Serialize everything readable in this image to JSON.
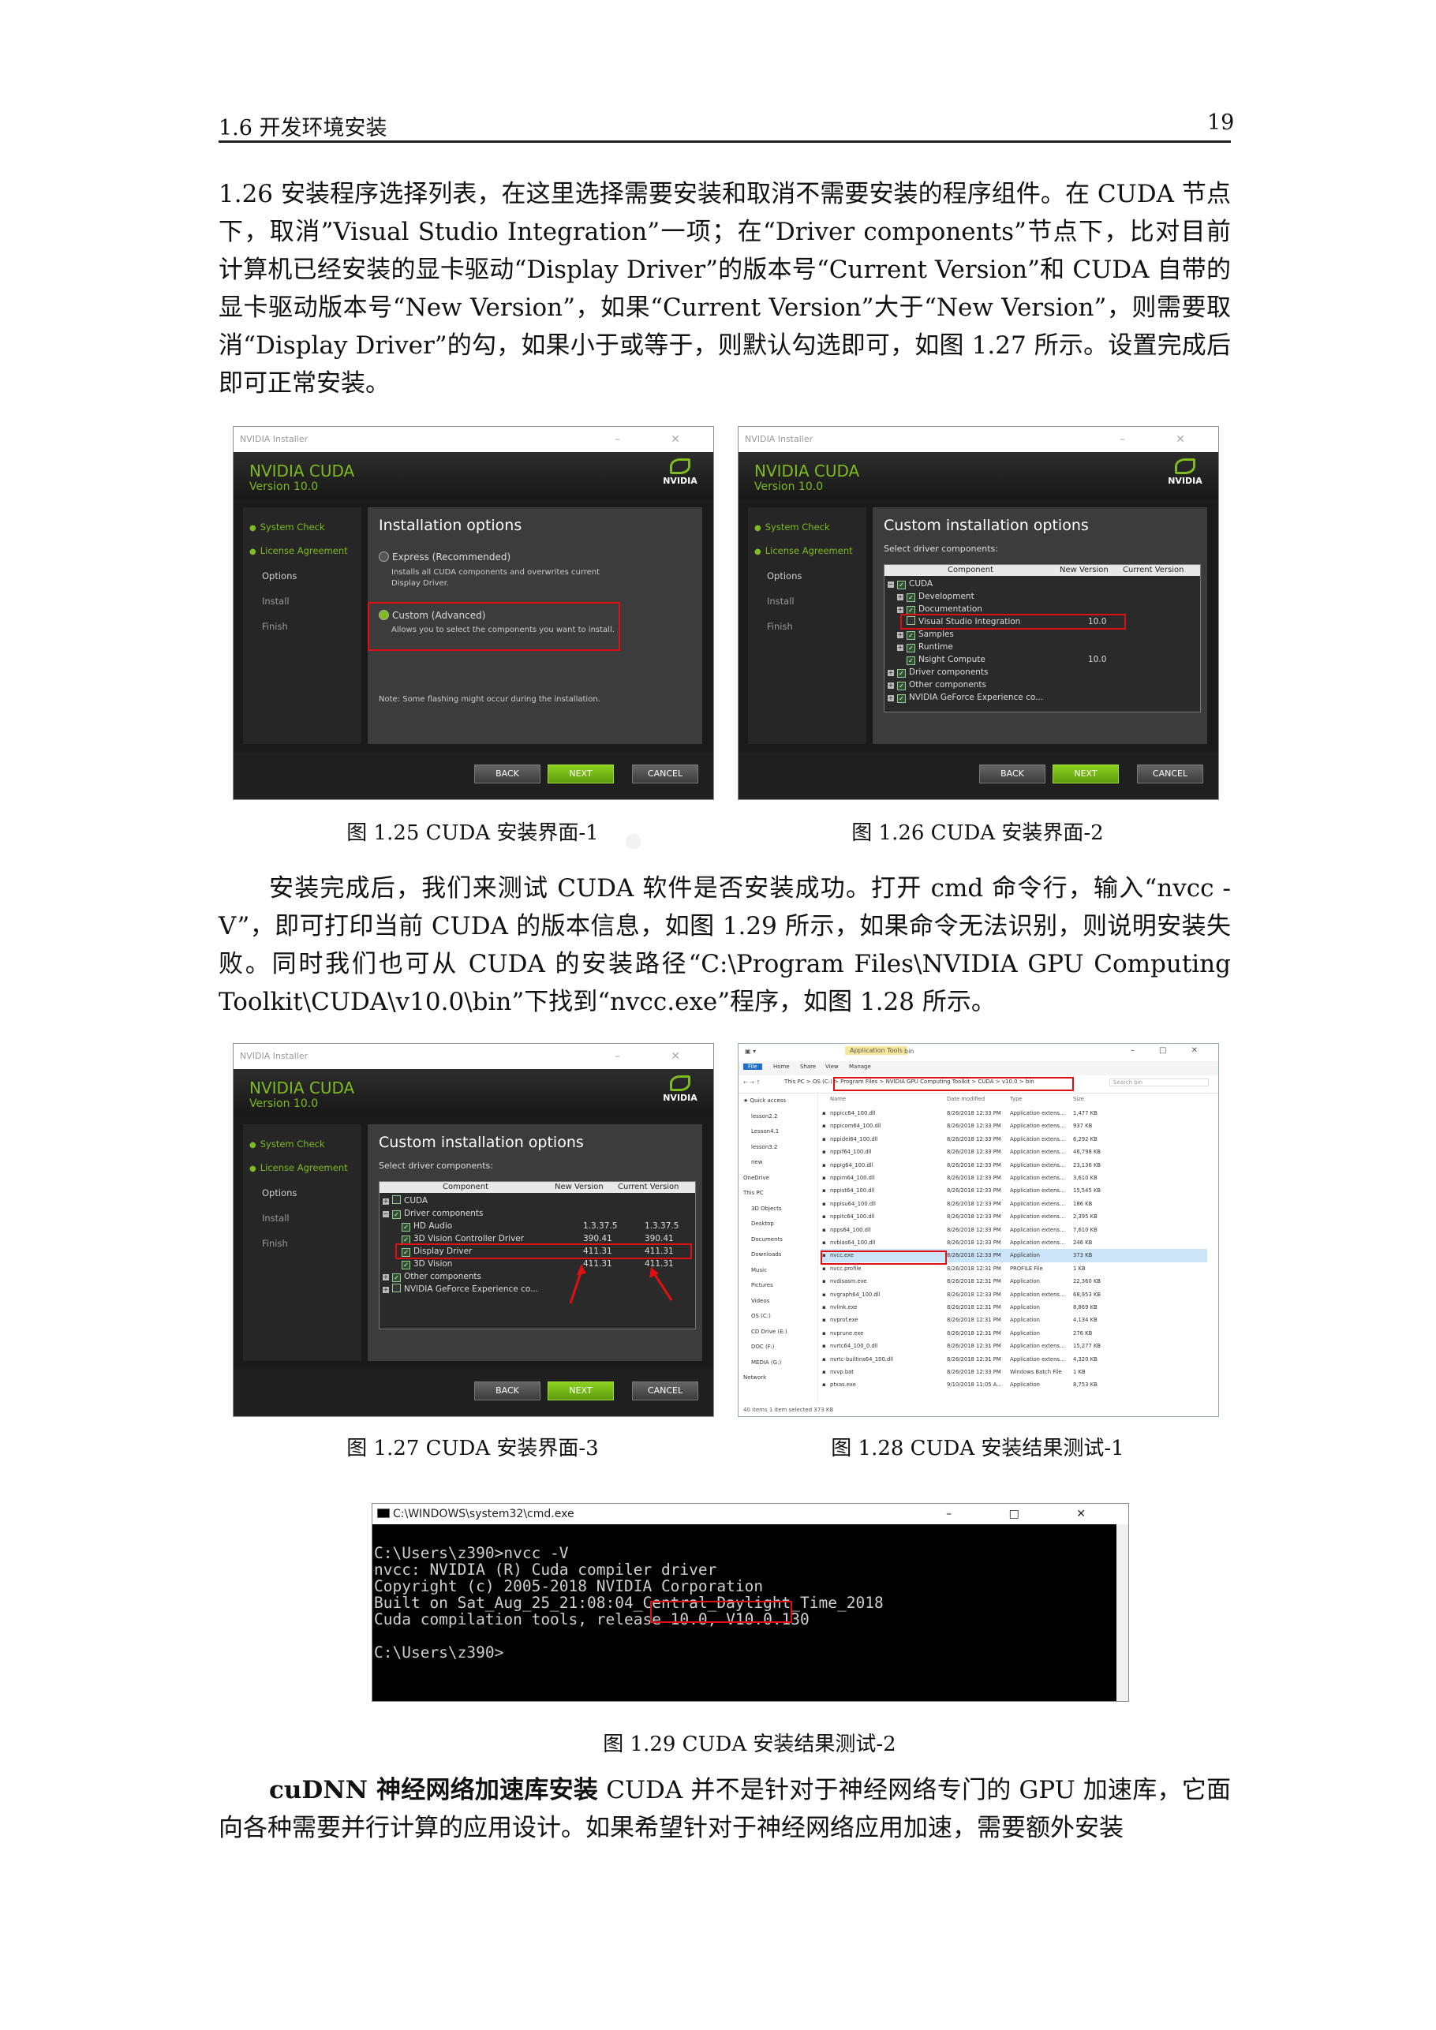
{
  "header": {
    "section": "1.6 开发环境安装",
    "page_number": "19"
  },
  "para1": "1.26 安装程序选择列表，在这里选择需要安装和取消不需要安装的程序组件。在 CUDA 节点下，取消”Visual Studio Integration”一项；在“Driver components”节点下，比对目前计算机已经安装的显卡驱动“Display Driver”的版本号“Current Version”和 CUDA 自带的显卡驱动版本号“New Version”，如果“Current Version”大于“New Version”，则需要取消“Display Driver”的勾，如果小于或等于，则默认勾选即可，如图 1.27 所示。设置完成后即可正常安装。",
  "para2": "安装完成后，我们来测试 CUDA 软件是否安装成功。打开 cmd 命令行，输入“nvcc -V”，即可打印当前 CUDA 的版本信息，如图 1.29 所示，如果命令无法识别，则说明安装失败。同时我们也可从 CUDA 的安装路径“C:\\Program Files\\NVIDIA GPU Computing Toolkit\\CUDA\\v10.0\\bin”下找到“nvcc.exe”程序，如图 1.28 所示。",
  "para3_bold": "cuDNN 神经网络加速库安装",
  "para3": "CUDA 并不是针对于神经网络专门的 GPU 加速库，它面向各种需要并行计算的应用设计。如果希望针对于神经网络应用加速，需要额外安装",
  "captions": {
    "fig125": "图 1.25 CUDA 安装界面-1",
    "fig126": "图 1.26 CUDA 安装界面-2",
    "fig127": "图 1.27 CUDA 安装界面-3",
    "fig128": "图 1.28 CUDA 安装结果测试-1",
    "fig129": "图 1.29 CUDA 安装结果测试-2"
  },
  "installer": {
    "window_title": "NVIDIA Installer",
    "product": "NVIDIA CUDA",
    "version": "Version 10.0",
    "logo": "NVIDIA",
    "steps": [
      "System Check",
      "License Agreement",
      "Options",
      "Install",
      "Finish"
    ],
    "buttons": {
      "back": "BACK",
      "next": "NEXT",
      "cancel": "CANCEL"
    }
  },
  "win1": {
    "heading": "Installation options",
    "express_label": "Express (Recommended)",
    "express_desc": "Installs all CUDA components and overwrites current Display Driver.",
    "custom_label": "Custom (Advanced)",
    "custom_desc": "Allows you to select the components you want to install.",
    "note": "Note: Some flashing might occur during the installation."
  },
  "win2": {
    "heading": "Custom installation options",
    "sub": "Select driver components:",
    "cols": [
      "Component",
      "New Version",
      "Current Version"
    ],
    "rows": [
      {
        "name": "CUDA",
        "new": "",
        "cur": ""
      },
      {
        "name": "Development",
        "new": "",
        "cur": ""
      },
      {
        "name": "Documentation",
        "new": "",
        "cur": ""
      },
      {
        "name": "Visual Studio Integration",
        "new": "10.0",
        "cur": ""
      },
      {
        "name": "Samples",
        "new": "",
        "cur": ""
      },
      {
        "name": "Runtime",
        "new": "",
        "cur": ""
      },
      {
        "name": "Nsight Compute",
        "new": "10.0",
        "cur": ""
      },
      {
        "name": "Driver components",
        "new": "",
        "cur": ""
      },
      {
        "name": "Other components",
        "new": "",
        "cur": ""
      },
      {
        "name": "NVIDIA GeForce Experience co...",
        "new": "",
        "cur": ""
      }
    ]
  },
  "win3": {
    "heading": "Custom installation options",
    "sub": "Select driver components:",
    "cols": [
      "Component",
      "New Version",
      "Current Version"
    ],
    "rows": [
      {
        "name": "CUDA",
        "new": "",
        "cur": ""
      },
      {
        "name": "Driver components",
        "new": "",
        "cur": ""
      },
      {
        "name": "HD Audio",
        "new": "1.3.37.5",
        "cur": "1.3.37.5"
      },
      {
        "name": "3D Vision Controller Driver",
        "new": "390.41",
        "cur": "390.41"
      },
      {
        "name": "Display Driver",
        "new": "411.31",
        "cur": "411.31"
      },
      {
        "name": "3D Vision",
        "new": "411.31",
        "cur": "411.31"
      },
      {
        "name": "Other components",
        "new": "",
        "cur": ""
      },
      {
        "name": "NVIDIA GeForce Experience co...",
        "new": "",
        "cur": ""
      }
    ]
  },
  "explorer": {
    "tabs": [
      "File",
      "Home",
      "Share",
      "View",
      "Manage"
    ],
    "context_tab": "Application Tools",
    "title": "bin",
    "path": "This PC > OS (C:) > Program Files > NVIDIA GPU Computing Toolkit > CUDA > v10.0 > bin",
    "search": "Search bin",
    "cols": [
      "Name",
      "Date modified",
      "Type",
      "Size"
    ],
    "nav": [
      "Quick access",
      "lesson2.2",
      "Lesson4.1",
      "lesson3.2",
      "new",
      "OneDrive",
      "This PC",
      "3D Objects",
      "Desktop",
      "Documents",
      "Downloads",
      "Music",
      "Pictures",
      "Videos",
      "OS (C:)",
      "CD Drive (E:)",
      "DOC (F:)",
      "MEDIA (G:)",
      "Network"
    ],
    "files": [
      {
        "n": "nppicc64_100.dll",
        "d": "8/26/2018 12:33 PM",
        "t": "Application extens...",
        "s": "1,477 KB"
      },
      {
        "n": "nppicom64_100.dll",
        "d": "8/26/2018 12:33 PM",
        "t": "Application extens...",
        "s": "937 KB"
      },
      {
        "n": "nppidei64_100.dll",
        "d": "8/26/2018 12:33 PM",
        "t": "Application extens...",
        "s": "6,292 KB"
      },
      {
        "n": "nppif64_100.dll",
        "d": "8/26/2018 12:33 PM",
        "t": "Application extens...",
        "s": "46,798 KB"
      },
      {
        "n": "nppig64_100.dll",
        "d": "8/26/2018 12:33 PM",
        "t": "Application extens...",
        "s": "23,136 KB"
      },
      {
        "n": "nppim64_100.dll",
        "d": "8/26/2018 12:33 PM",
        "t": "Application extens...",
        "s": "3,610 KB"
      },
      {
        "n": "nppist64_100.dll",
        "d": "8/26/2018 12:33 PM",
        "t": "Application extens...",
        "s": "15,545 KB"
      },
      {
        "n": "nppisu64_100.dll",
        "d": "8/26/2018 12:33 PM",
        "t": "Application extens...",
        "s": "186 KB"
      },
      {
        "n": "nppitc64_100.dll",
        "d": "8/26/2018 12:33 PM",
        "t": "Application extens...",
        "s": "2,395 KB"
      },
      {
        "n": "npps64_100.dll",
        "d": "8/26/2018 12:33 PM",
        "t": "Application extens...",
        "s": "7,610 KB"
      },
      {
        "n": "nvblas64_100.dll",
        "d": "8/26/2018 12:33 PM",
        "t": "Application extens...",
        "s": "246 KB"
      },
      {
        "n": "nvcc.exe",
        "d": "8/26/2018 12:33 PM",
        "t": "Application",
        "s": "373 KB"
      },
      {
        "n": "nvcc.profile",
        "d": "8/26/2018 12:31 PM",
        "t": "PROFILE File",
        "s": "1 KB"
      },
      {
        "n": "nvdisasm.exe",
        "d": "8/26/2018 12:31 PM",
        "t": "Application",
        "s": "22,360 KB"
      },
      {
        "n": "nvgraph64_100.dll",
        "d": "8/26/2018 12:33 PM",
        "t": "Application extens...",
        "s": "68,953 KB"
      },
      {
        "n": "nvlink.exe",
        "d": "8/26/2018 12:31 PM",
        "t": "Application",
        "s": "8,869 KB"
      },
      {
        "n": "nvprof.exe",
        "d": "8/26/2018 12:31 PM",
        "t": "Application",
        "s": "4,134 KB"
      },
      {
        "n": "nvprune.exe",
        "d": "8/26/2018 12:31 PM",
        "t": "Application",
        "s": "276 KB"
      },
      {
        "n": "nvrtc64_100_0.dll",
        "d": "8/26/2018 12:31 PM",
        "t": "Application extens...",
        "s": "15,277 KB"
      },
      {
        "n": "nvrtc-builtins64_100.dll",
        "d": "8/26/2018 12:31 PM",
        "t": "Application extens...",
        "s": "4,320 KB"
      },
      {
        "n": "nvvp.bat",
        "d": "8/26/2018 12:33 PM",
        "t": "Windows Batch File",
        "s": "1 KB"
      },
      {
        "n": "ptxas.exe",
        "d": "9/10/2018 11:05 A...",
        "t": "Application",
        "s": "8,753 KB"
      }
    ],
    "status": "40 items    1 item selected  373 KB"
  },
  "cmd": {
    "title": "C:\\WINDOWS\\system32\\cmd.exe",
    "lines": [
      "C:\\Users\\z390>nvcc -V",
      "nvcc: NVIDIA (R) Cuda compiler driver",
      "Copyright (c) 2005-2018 NVIDIA Corporation",
      "Built on Sat_Aug_25_21:08:04_Central_Daylight_Time_2018",
      "Cuda compilation tools, release 10.0, V10.0.130",
      "",
      "C:\\Users\\z390>"
    ]
  },
  "colors": {
    "nvidia_green": "#7dbb21",
    "highlight_red": "#e01010"
  }
}
